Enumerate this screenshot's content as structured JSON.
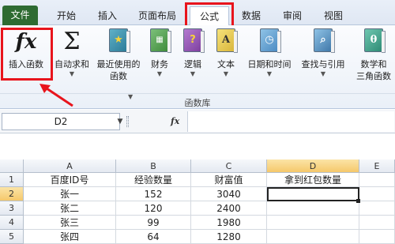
{
  "tabs": {
    "file": "文件",
    "home": "开始",
    "insert": "插入",
    "page_layout": "页面布局",
    "formulas": "公式",
    "data": "数据",
    "review": "审阅",
    "view": "视图"
  },
  "ribbon": {
    "insert_function": {
      "icon": "fx",
      "label": "插入函数"
    },
    "autosum": {
      "icon": "Σ",
      "label": "自动求和",
      "dropdown": true
    },
    "recently_used": {
      "label_line1": "最近使用的",
      "label_line2": "函数",
      "dropdown": true
    },
    "financial": {
      "label": "财务",
      "dropdown": true
    },
    "logical": {
      "label": "逻辑",
      "dropdown": true
    },
    "text": {
      "label": "文本",
      "dropdown": true
    },
    "datetime": {
      "label": "日期和时间",
      "dropdown": true
    },
    "lookup": {
      "label": "查找与引用",
      "dropdown": true
    },
    "math": {
      "label_line1": "数学和",
      "label_line2": "三角函数",
      "dropdown": true
    },
    "group_label": "函数库"
  },
  "formula_bar": {
    "name_box": "D2",
    "fx_label": "fx",
    "content": ""
  },
  "sheet": {
    "columns": [
      "A",
      "B",
      "C",
      "D",
      "E"
    ],
    "rows": [
      {
        "num": "1",
        "cells": [
          "百度ID号",
          "经验数量",
          "财富值",
          "拿到红包数量",
          ""
        ]
      },
      {
        "num": "2",
        "cells": [
          "张一",
          "152",
          "3040",
          "",
          ""
        ]
      },
      {
        "num": "3",
        "cells": [
          "张二",
          "120",
          "2400",
          "",
          ""
        ]
      },
      {
        "num": "4",
        "cells": [
          "张三",
          "99",
          "1980",
          "",
          ""
        ]
      },
      {
        "num": "5",
        "cells": [
          "张四",
          "64",
          "1280",
          "",
          ""
        ]
      }
    ],
    "active_cell": "D2"
  },
  "colors": {
    "file_tab": "#2e6b32",
    "highlight_box": "#e8141c",
    "selected_header": "#f5c86b"
  }
}
